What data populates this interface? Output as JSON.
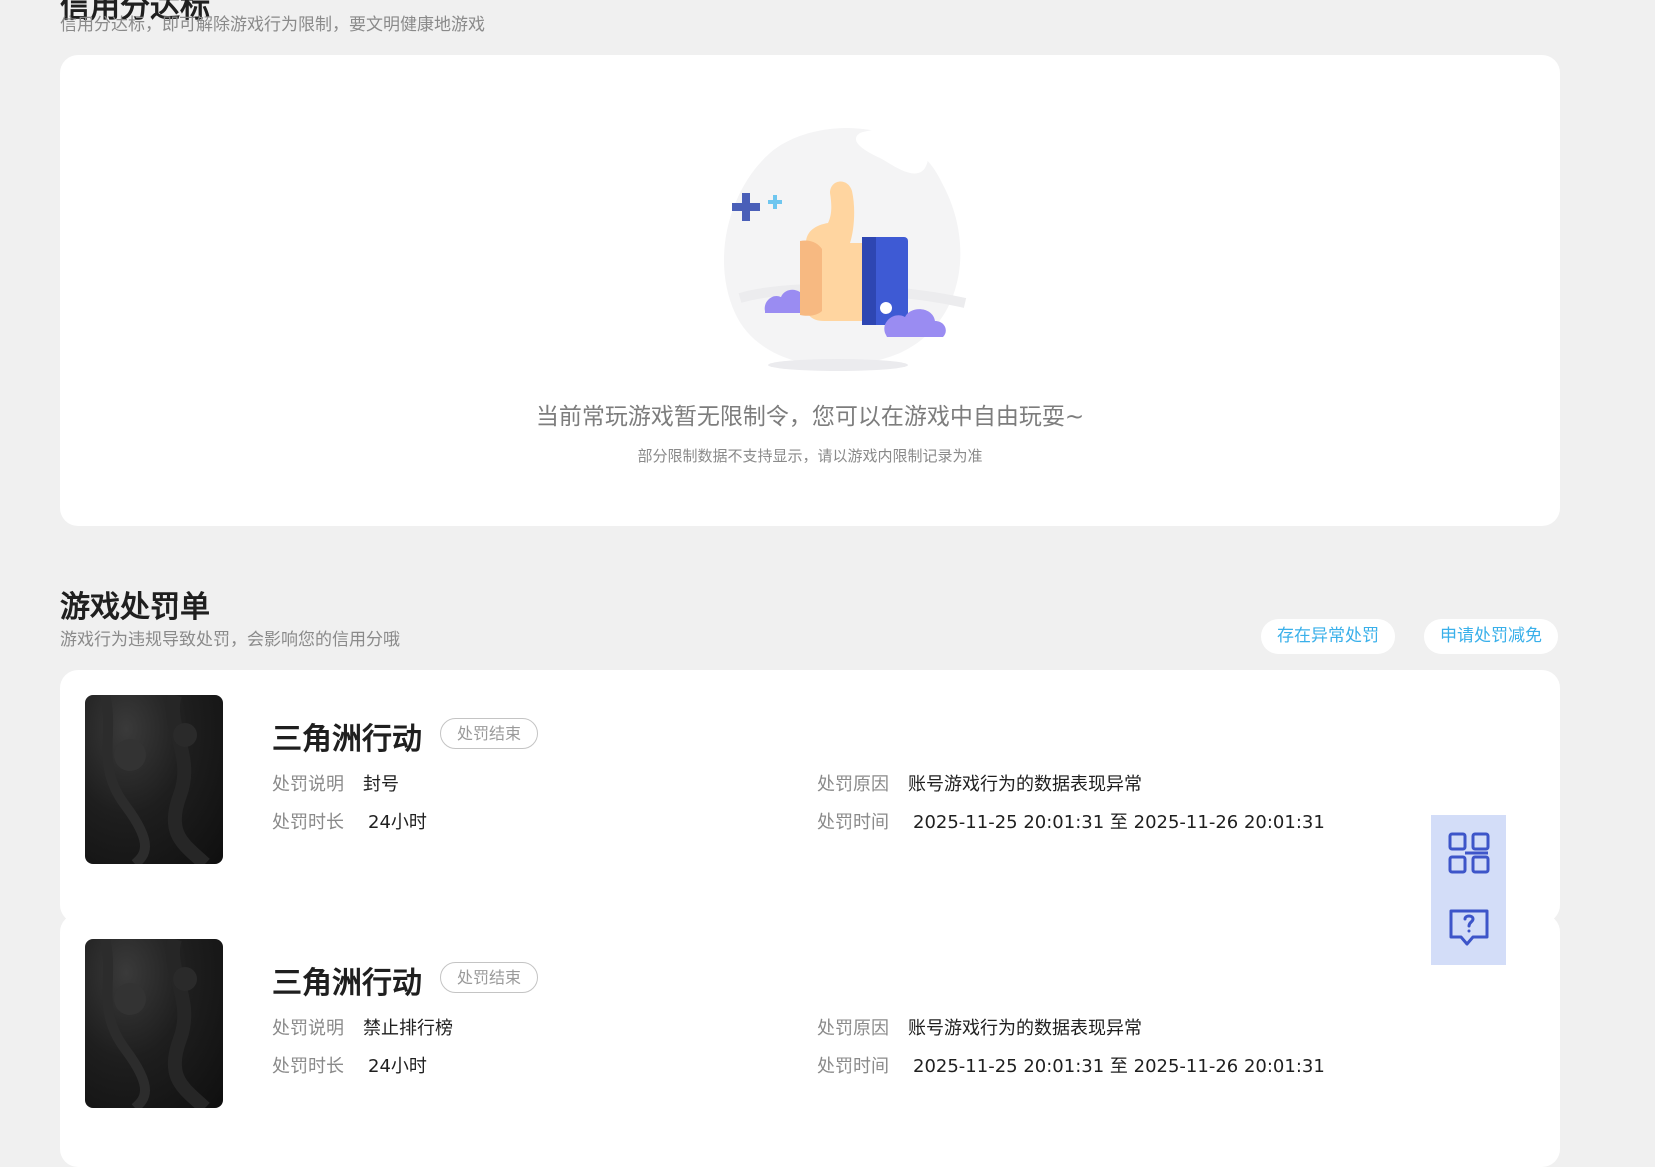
{
  "credit_section": {
    "title": "信用分达标",
    "desc": "信用分达标，即可解除游戏行为限制，要文明健康地游戏"
  },
  "empty_state": {
    "illustration": "thumbs-up-illustration",
    "main_text": "当前常玩游戏暂无限制令，您可以在游戏中自由玩耍~",
    "sub_text": "部分限制数据不支持显示，请以游戏内限制记录为准"
  },
  "penalty_section": {
    "title": "游戏处罚单",
    "desc": "游戏行为违规导致处罚，会影响您的信用分哦",
    "buttons": {
      "abnormal": "存在异常处罚",
      "reduce": "申请处罚减免"
    }
  },
  "labels": {
    "desc": "处罚说明",
    "duration": "处罚时长",
    "reason": "处罚原因",
    "time": "处罚时间"
  },
  "penalties": [
    {
      "game": "三角洲行动",
      "status": "处罚结束",
      "desc": "封号",
      "duration": "24小时",
      "reason": "账号游戏行为的数据表现异常",
      "time": "2025-11-25 20:01:31 至 2025-11-26 20:01:31"
    },
    {
      "game": "三角洲行动",
      "status": "处罚结束",
      "desc": "禁止排行榜",
      "duration": "24小时",
      "reason": "账号游戏行为的数据表现异常",
      "time": "2025-11-25 20:01:31 至 2025-11-26 20:01:31"
    }
  ],
  "float_bar": {
    "icons": [
      "qrcode-icon",
      "help-chat-icon"
    ]
  },
  "colors": {
    "accent": "#3ab0ea",
    "icon_blue": "#3d55c9",
    "float_bg": "#d3ddf8"
  }
}
